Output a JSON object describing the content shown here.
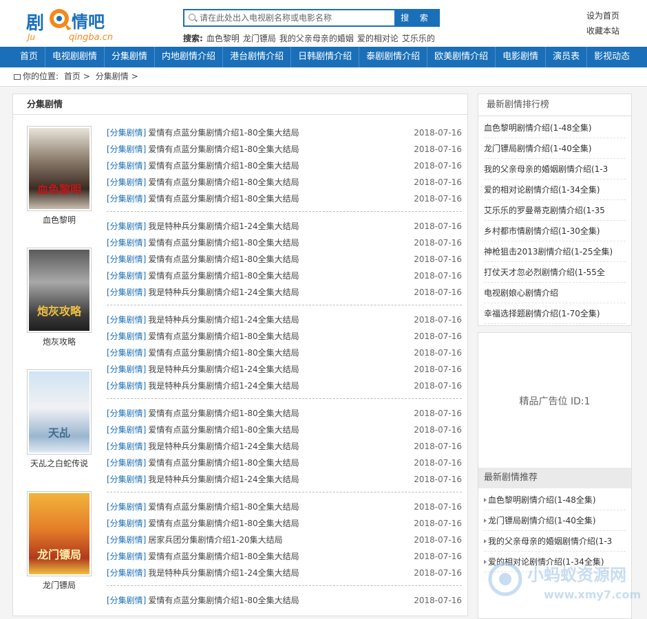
{
  "header": {
    "logo": {
      "main": "剧情吧",
      "sub_left": "Ju",
      "sub_right": "qingba.cn"
    },
    "search": {
      "placeholder": "请在此处出入电视剧名称或电影名称",
      "button": "搜 索"
    },
    "hot": {
      "label": "搜索:",
      "items": [
        "血色黎明",
        "龙门镖局",
        "我的父亲母亲的婚姻",
        "爱的相对论",
        "艾乐乐的"
      ]
    },
    "links": [
      "设为首页",
      "收藏本站"
    ]
  },
  "nav": [
    "首页",
    "电视剧剧情",
    "分集剧情",
    "内地剧情介绍",
    "港台剧情介绍",
    "日韩剧情介绍",
    "泰剧剧情介绍",
    "欧美剧情介绍",
    "电影剧情",
    "演员表",
    "影视动态"
  ],
  "breadcrumb": {
    "label": "你的位置:",
    "items": [
      "首页",
      "分集剧情"
    ],
    "sep": ">"
  },
  "main": {
    "title": "分集剧情",
    "groups": [
      {
        "poster_caption": "血色黎明",
        "poster_text": "血色黎明",
        "rows": [
          {
            "tag": "[分集剧情]",
            "title": "爱情有点蓝分集剧情介绍1-80全集大结局",
            "date": "2018-07-16"
          },
          {
            "tag": "[分集剧情]",
            "title": "爱情有点蓝分集剧情介绍1-80全集大结局",
            "date": "2018-07-16"
          },
          {
            "tag": "[分集剧情]",
            "title": "爱情有点蓝分集剧情介绍1-80全集大结局",
            "date": "2018-07-16"
          },
          {
            "tag": "[分集剧情]",
            "title": "爱情有点蓝分集剧情介绍1-80全集大结局",
            "date": "2018-07-16"
          },
          {
            "tag": "[分集剧情]",
            "title": "爱情有点蓝分集剧情介绍1-80全集大结局",
            "date": "2018-07-16"
          }
        ]
      },
      {
        "poster_caption": "炮灰攻略",
        "poster_text": "炮灰攻略",
        "rows": [
          {
            "tag": "[分集剧情]",
            "title": "我是特种兵分集剧情介绍1-24全集大结局",
            "date": "2018-07-16"
          },
          {
            "tag": "[分集剧情]",
            "title": "爱情有点蓝分集剧情介绍1-80全集大结局",
            "date": "2018-07-16"
          },
          {
            "tag": "[分集剧情]",
            "title": "爱情有点蓝分集剧情介绍1-80全集大结局",
            "date": "2018-07-16"
          },
          {
            "tag": "[分集剧情]",
            "title": "爱情有点蓝分集剧情介绍1-80全集大结局",
            "date": "2018-07-16"
          },
          {
            "tag": "[分集剧情]",
            "title": "我是特种兵分集剧情介绍1-24全集大结局",
            "date": "2018-07-16"
          }
        ]
      },
      {
        "poster_caption": "天乩之白蛇传说",
        "poster_text": "天乩",
        "rows": [
          {
            "tag": "[分集剧情]",
            "title": "我是特种兵分集剧情介绍1-24全集大结局",
            "date": "2018-07-16"
          },
          {
            "tag": "[分集剧情]",
            "title": "爱情有点蓝分集剧情介绍1-80全集大结局",
            "date": "2018-07-16"
          },
          {
            "tag": "[分集剧情]",
            "title": "爱情有点蓝分集剧情介绍1-80全集大结局",
            "date": "2018-07-16"
          },
          {
            "tag": "[分集剧情]",
            "title": "我是特种兵分集剧情介绍1-24全集大结局",
            "date": "2018-07-16"
          },
          {
            "tag": "[分集剧情]",
            "title": "我是特种兵分集剧情介绍1-24全集大结局",
            "date": "2018-07-16"
          }
        ]
      },
      {
        "poster_caption": "龙门镖局",
        "poster_text": "龙门镖局",
        "rows": [
          {
            "tag": "[分集剧情]",
            "title": "爱情有点蓝分集剧情介绍1-80全集大结局",
            "date": "2018-07-16"
          },
          {
            "tag": "[分集剧情]",
            "title": "爱情有点蓝分集剧情介绍1-80全集大结局",
            "date": "2018-07-16"
          },
          {
            "tag": "[分集剧情]",
            "title": "我是特种兵分集剧情介绍1-24全集大结局",
            "date": "2018-07-16"
          },
          {
            "tag": "[分集剧情]",
            "title": "爱情有点蓝分集剧情介绍1-80全集大结局",
            "date": "2018-07-16"
          },
          {
            "tag": "[分集剧情]",
            "title": "我是特种兵分集剧情介绍1-24全集大结局",
            "date": "2018-07-16"
          }
        ]
      },
      {
        "poster_caption": "",
        "poster_text": "",
        "rows": [
          {
            "tag": "[分集剧情]",
            "title": "爱情有点蓝分集剧情介绍1-80全集大结局",
            "date": "2018-07-16"
          },
          {
            "tag": "[分集剧情]",
            "title": "爱情有点蓝分集剧情介绍1-80全集大结局",
            "date": "2018-07-16"
          },
          {
            "tag": "[分集剧情]",
            "title": "居家兵团分集剧情介绍1-20集大结局",
            "date": "2018-07-16"
          },
          {
            "tag": "[分集剧情]",
            "title": "爱情有点蓝分集剧情介绍1-80全集大结局",
            "date": "2018-07-16"
          },
          {
            "tag": "[分集剧情]",
            "title": "我是特种兵分集剧情介绍1-24全集大结局",
            "date": "2018-07-16"
          }
        ]
      },
      {
        "poster_caption": "",
        "poster_text": "",
        "rows": [
          {
            "tag": "[分集剧情]",
            "title": "爱情有点蓝分集剧情介绍1-80全集大结局",
            "date": "2018-07-16"
          }
        ]
      }
    ]
  },
  "sidebar": {
    "rank_title": "最新剧情排行榜",
    "rank": [
      "血色黎明剧情介绍(1-48全集)",
      "龙门镖局剧情介绍(1-40全集)",
      "我的父亲母亲的婚姻剧情介绍(1-3",
      "爱的相对论剧情介绍(1-34全集)",
      "艾乐乐的罗曼蒂克剧情介绍(1-35",
      "乡村都市情剧情介绍(1-30全集)",
      "神枪狙击2013剧情介绍(1-25全集)",
      "打仗天才忽必烈剧情介绍(1-55全",
      "电视剧娘心剧情介绍",
      "幸福选择题剧情介绍(1-70全集)"
    ],
    "ad": "精品广告位 ID:1",
    "rec_title": "最新剧情推荐",
    "rec": [
      "血色黎明剧情介绍(1-48全集)",
      "龙门镖局剧情介绍(1-40全集)",
      "我的父亲母亲的婚姻剧情介绍(1-3",
      "爱的相对论剧情介绍(1-34全集)"
    ]
  },
  "watermark": {
    "main": "小蚂蚁资源网",
    "url": "www.xmy7.com"
  },
  "colors": {
    "brand": "#1a6fb8",
    "orange": "#f28a1b"
  }
}
